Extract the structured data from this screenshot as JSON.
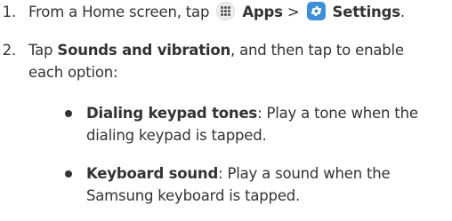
{
  "step1": {
    "number": "1.",
    "prefix": "From a Home screen, tap",
    "apps_label": "Apps",
    "separator": ">",
    "settings_label": "Settings",
    "end": ".",
    "icons": [
      "apps-icon",
      "settings-icon"
    ]
  },
  "step2": {
    "number": "2.",
    "prefix": "Tap",
    "bold": "Sounds and vibration",
    "suffix": ", and then tap to enable",
    "line2": "each option:"
  },
  "options": [
    {
      "title": "Dialing keypad tones",
      "desc_line1": ": Play a tone when the",
      "desc_line2": "dialing keypad is tapped."
    },
    {
      "title": "Keyboard sound",
      "desc_line1": ": Play a sound when the",
      "desc_line2": "Samsung keyboard is tapped."
    }
  ],
  "colors": {
    "text": "#333333",
    "settings_icon": "#3f8fd6"
  }
}
